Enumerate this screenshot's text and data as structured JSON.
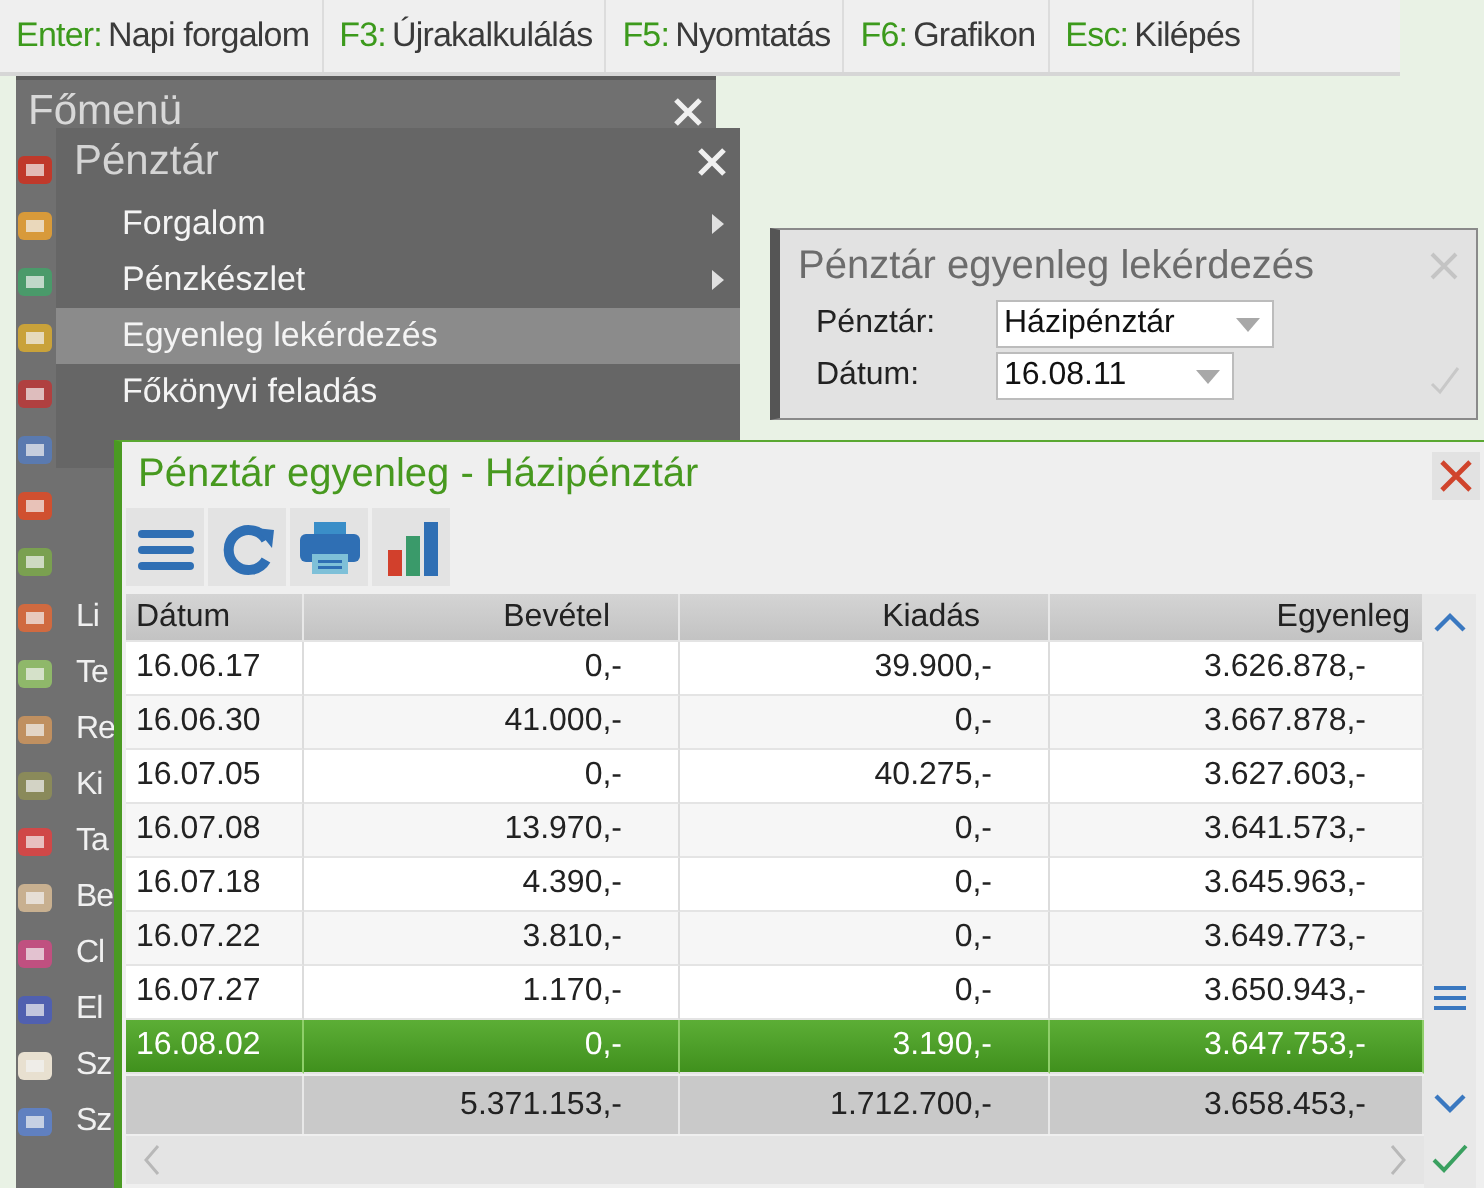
{
  "shortcuts": [
    {
      "key": "Enter:",
      "label": "Napi forgalom"
    },
    {
      "key": "F3:",
      "label": "Újrakalkulálás"
    },
    {
      "key": "F5:",
      "label": "Nyomtatás"
    },
    {
      "key": "F6:",
      "label": "Grafikon"
    },
    {
      "key": "Esc:",
      "label": "Kilépés"
    }
  ],
  "main_menu": {
    "title": "Főmenü",
    "items": [
      {
        "label": "Li"
      },
      {
        "label": "Te"
      },
      {
        "label": "Re"
      },
      {
        "label": "Ki"
      },
      {
        "label": "Ta"
      },
      {
        "label": "Be"
      },
      {
        "label": "Cl"
      },
      {
        "label": "El"
      },
      {
        "label": "Sz"
      },
      {
        "label": "Sz"
      }
    ]
  },
  "submenu": {
    "title": "Pénztár",
    "items": [
      {
        "label": "Forgalom",
        "has_submenu": true,
        "selected": false
      },
      {
        "label": "Pénzkészlet",
        "has_submenu": true,
        "selected": false
      },
      {
        "label": "Egyenleg lekérdezés",
        "has_submenu": false,
        "selected": true
      },
      {
        "label": "Főkönyvi feladás",
        "has_submenu": false,
        "selected": false
      }
    ]
  },
  "query_dialog": {
    "title": "Pénztár egyenleg lekérdezés",
    "fields": [
      {
        "label": "Pénztár:",
        "value": "Házipénztár"
      },
      {
        "label": "Dátum:",
        "value": "16.08.11"
      }
    ]
  },
  "balance_window": {
    "title": "Pénztár egyenleg - Házipénztár",
    "table": {
      "columns": [
        "Dátum",
        "Bevétel",
        "Kiadás",
        "Egyenleg"
      ],
      "rows": [
        {
          "cells": [
            "16.06.17",
            "0,-",
            "39.900,-",
            "3.626.878,-"
          ],
          "selected": false
        },
        {
          "cells": [
            "16.06.30",
            "41.000,-",
            "0,-",
            "3.667.878,-"
          ],
          "selected": false
        },
        {
          "cells": [
            "16.07.05",
            "0,-",
            "40.275,-",
            "3.627.603,-"
          ],
          "selected": false
        },
        {
          "cells": [
            "16.07.08",
            "13.970,-",
            "0,-",
            "3.641.573,-"
          ],
          "selected": false
        },
        {
          "cells": [
            "16.07.18",
            "4.390,-",
            "0,-",
            "3.645.963,-"
          ],
          "selected": false
        },
        {
          "cells": [
            "16.07.22",
            "3.810,-",
            "0,-",
            "3.649.773,-"
          ],
          "selected": false
        },
        {
          "cells": [
            "16.07.27",
            "1.170,-",
            "0,-",
            "3.650.943,-"
          ],
          "selected": false
        },
        {
          "cells": [
            "16.08.02",
            "0,-",
            "3.190,-",
            "3.647.753,-"
          ],
          "selected": true
        }
      ],
      "totals": [
        "5.371.153,-",
        "1.712.700,-",
        "3.658.453,-"
      ]
    }
  }
}
